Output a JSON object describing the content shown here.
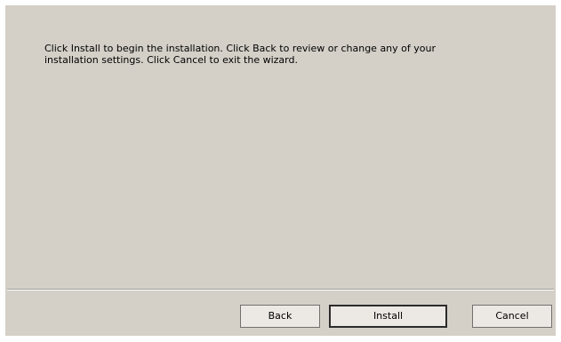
{
  "dialog": {
    "message_line1": "Click Install to begin the installation. Click Back to review or change any of your",
    "message_line2": "installation settings. Click Cancel to exit the wizard."
  },
  "buttons": {
    "back_label": "Back",
    "install_label": "Install",
    "cancel_label": "Cancel"
  },
  "colors": {
    "dialog_background": "#d4d0c8",
    "page_background": "#ffffff"
  }
}
